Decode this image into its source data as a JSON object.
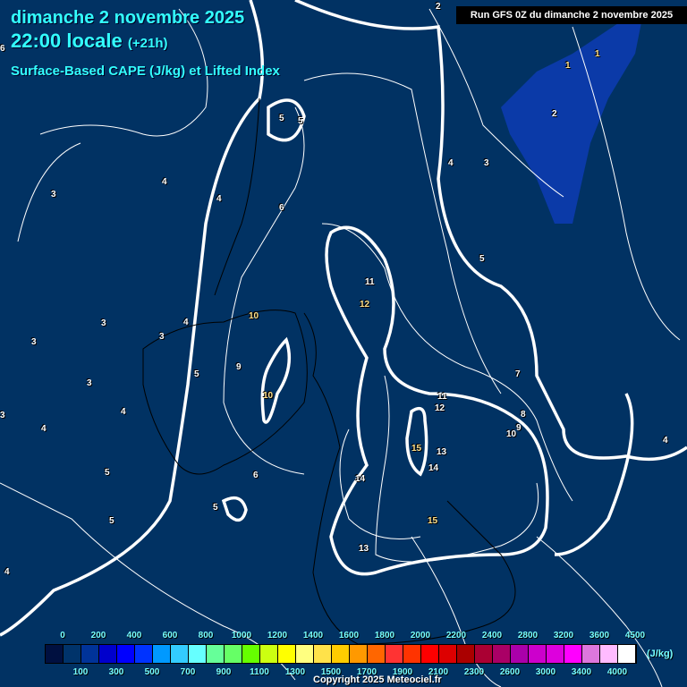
{
  "header": {
    "date": "dimanche 2 novembre 2025",
    "time": "22:00 locale",
    "offset": "(+21h)",
    "parameter": "Surface-Based CAPE (J/kg) et Lifted Index",
    "run": "Run GFS 0Z du dimanche 2 novembre 2025"
  },
  "colors": {
    "background": "#013263",
    "shade_area": "#0b3aa8",
    "title": "#33ffff"
  },
  "contour_labels": [
    "2",
    "1",
    "1",
    "2",
    "3",
    "4",
    "5",
    "7",
    "8",
    "9",
    "10",
    "4",
    "6",
    "5",
    "5",
    "4",
    "3",
    "3",
    "3",
    "3",
    "4",
    "3",
    "5",
    "5",
    "4",
    "6",
    "6",
    "4",
    "4",
    "5",
    "4",
    "3",
    "10",
    "9",
    "10",
    "11",
    "12",
    "11",
    "12",
    "15",
    "13",
    "14",
    "14",
    "15",
    "13",
    "5"
  ],
  "legend": {
    "unit": "(J/kg)",
    "colors": [
      "#001040",
      "#00336a",
      "#003399",
      "#0000cc",
      "#0000ff",
      "#0033ff",
      "#0099ff",
      "#33ccff",
      "#66ffff",
      "#66ff99",
      "#66ff66",
      "#66ff00",
      "#ccff11",
      "#ffff00",
      "#ffff80",
      "#ffe24a",
      "#ffcc00",
      "#ff9900",
      "#ff6600",
      "#ff3333",
      "#ff3300",
      "#ff0000",
      "#dd0000",
      "#aa0000",
      "#aa0033",
      "#aa0066",
      "#aa00aa",
      "#cc00cc",
      "#dd00dd",
      "#ff00ff",
      "#dd77dd",
      "#ffbbff",
      "#ffffff"
    ],
    "top_ticks": [
      "0",
      "200",
      "400",
      "600",
      "800",
      "1000",
      "1200",
      "1400",
      "1600",
      "1800",
      "2000",
      "2200",
      "2400",
      "2800",
      "3200",
      "3600",
      "4500"
    ],
    "bottom_ticks": [
      "100",
      "300",
      "500",
      "700",
      "900",
      "1100",
      "1300",
      "1500",
      "1700",
      "1900",
      "2100",
      "2300",
      "2600",
      "3000",
      "3400",
      "4000"
    ]
  },
  "copyright": "Copyright 2025 Meteociel.fr"
}
